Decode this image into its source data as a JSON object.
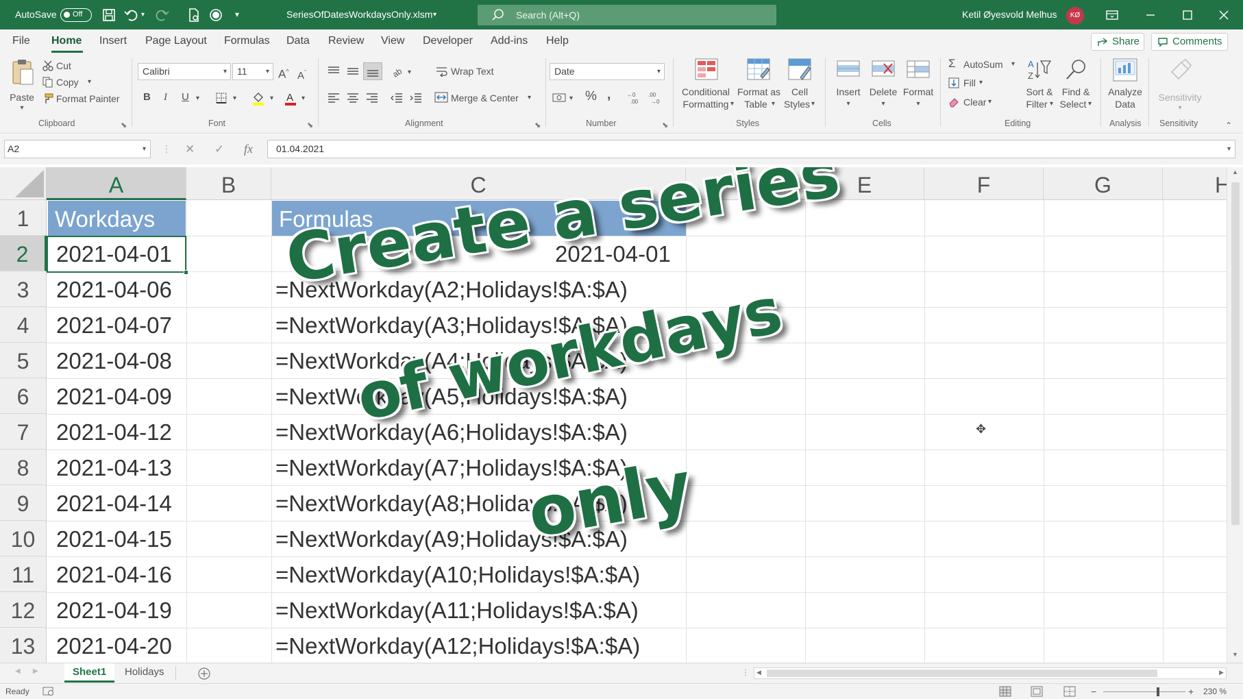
{
  "titlebar": {
    "autosave_label": "AutoSave",
    "autosave_state": "Off",
    "filename": "SeriesOfDatesWorkdaysOnly.xlsm",
    "search_placeholder": "Search (Alt+Q)",
    "user_name": "Ketil Øyesvold Melhus",
    "user_initials": "KØ"
  },
  "tabs": [
    "File",
    "Home",
    "Insert",
    "Page Layout",
    "Formulas",
    "Data",
    "Review",
    "View",
    "Developer",
    "Add-ins",
    "Help"
  ],
  "active_tab": "Home",
  "share_label": "Share",
  "comments_label": "Comments",
  "ribbon": {
    "clipboard": {
      "paste": "Paste",
      "cut": "Cut",
      "copy": "Copy",
      "format_painter": "Format Painter",
      "group": "Clipboard"
    },
    "font": {
      "name": "Calibri",
      "size": "11",
      "group": "Font",
      "bold": "B",
      "italic": "I",
      "underline": "U"
    },
    "alignment": {
      "wrap_text": "Wrap Text",
      "merge_center": "Merge & Center",
      "group": "Alignment"
    },
    "number": {
      "format": "Date",
      "group": "Number"
    },
    "styles": {
      "conditional": [
        "Conditional",
        "Formatting"
      ],
      "format_table": [
        "Format as",
        "Table"
      ],
      "cell_styles": [
        "Cell",
        "Styles"
      ],
      "group": "Styles"
    },
    "cells": {
      "insert": "Insert",
      "delete": "Delete",
      "format": "Format",
      "group": "Cells"
    },
    "editing": {
      "autosum": "AutoSum",
      "fill": "Fill",
      "clear": "Clear",
      "sort_filter": [
        "Sort &",
        "Filter"
      ],
      "find_select": [
        "Find &",
        "Select"
      ],
      "group": "Editing"
    },
    "analysis": {
      "analyze": [
        "Analyze",
        "Data"
      ],
      "group": "Analysis"
    },
    "sensitivity": {
      "label": "Sensitivity",
      "group": "Sensitivity"
    }
  },
  "formula_bar": {
    "name_box": "A2",
    "fx": "fx",
    "content": "01.04.2021"
  },
  "grid": {
    "columns": [
      "A",
      "B",
      "C",
      "E",
      "F",
      "G",
      "H"
    ],
    "rows": [
      "1",
      "2",
      "3",
      "4",
      "5",
      "6",
      "7",
      "8",
      "9",
      "10",
      "11",
      "12",
      "13"
    ],
    "a1": "Workdays",
    "c1": "Formulas",
    "workdays": [
      "2021-04-01",
      "2021-04-06",
      "2021-04-07",
      "2021-04-08",
      "2021-04-09",
      "2021-04-12",
      "2021-04-13",
      "2021-04-14",
      "2021-04-15",
      "2021-04-16",
      "2021-04-19",
      "2021-04-20"
    ],
    "c2": "2021-04-01",
    "formulas": [
      "=NextWorkday(A2;Holidays!$A:$A)",
      "=NextWorkday(A3;Holidays!$A:$A)",
      "=NextWorkday(A4;Holidays!$A:$A)",
      "=NextWorkday(A5;Holidays!$A:$A)",
      "=NextWorkday(A6;Holidays!$A:$A)",
      "=NextWorkday(A7;Holidays!$A:$A)",
      "=NextWorkday(A8;Holidays!$A:$A)",
      "=NextWorkday(A9;Holidays!$A:$A)",
      "=NextWorkday(A10;Holidays!$A:$A)",
      "=NextWorkday(A11;Holidays!$A:$A)",
      "=NextWorkday(A12;Holidays!$A:$A)"
    ]
  },
  "overlay": {
    "line1": "Create a series",
    "line2": "of workdays",
    "line3": "only"
  },
  "sheets": [
    "Sheet1",
    "Holidays"
  ],
  "active_sheet": "Sheet1",
  "status": {
    "ready": "Ready",
    "zoom": "230 %"
  },
  "colors": {
    "excel_green": "#217346",
    "header_fill": "#7ca4cf",
    "overlay_text": "#1f6f44"
  }
}
